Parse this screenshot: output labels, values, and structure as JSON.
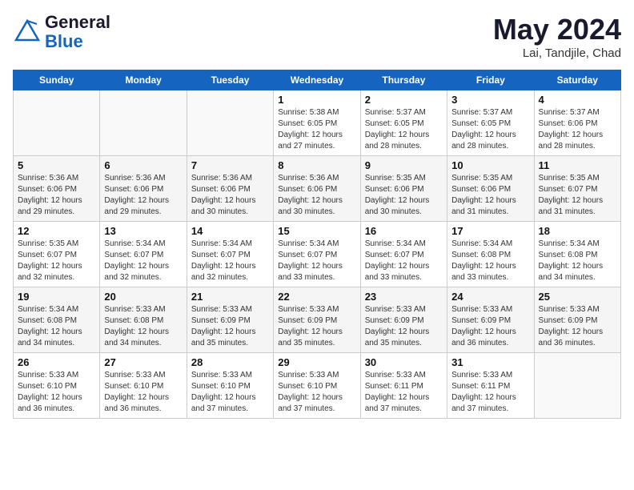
{
  "header": {
    "logo_general": "General",
    "logo_blue": "Blue",
    "month_year": "May 2024",
    "location": "Lai, Tandjile, Chad"
  },
  "days_of_week": [
    "Sunday",
    "Monday",
    "Tuesday",
    "Wednesday",
    "Thursday",
    "Friday",
    "Saturday"
  ],
  "weeks": [
    {
      "shade": false,
      "days": [
        {
          "number": "",
          "info": ""
        },
        {
          "number": "",
          "info": ""
        },
        {
          "number": "",
          "info": ""
        },
        {
          "number": "1",
          "info": "Sunrise: 5:38 AM\nSunset: 6:05 PM\nDaylight: 12 hours\nand 27 minutes."
        },
        {
          "number": "2",
          "info": "Sunrise: 5:37 AM\nSunset: 6:05 PM\nDaylight: 12 hours\nand 28 minutes."
        },
        {
          "number": "3",
          "info": "Sunrise: 5:37 AM\nSunset: 6:05 PM\nDaylight: 12 hours\nand 28 minutes."
        },
        {
          "number": "4",
          "info": "Sunrise: 5:37 AM\nSunset: 6:06 PM\nDaylight: 12 hours\nand 28 minutes."
        }
      ]
    },
    {
      "shade": true,
      "days": [
        {
          "number": "5",
          "info": "Sunrise: 5:36 AM\nSunset: 6:06 PM\nDaylight: 12 hours\nand 29 minutes."
        },
        {
          "number": "6",
          "info": "Sunrise: 5:36 AM\nSunset: 6:06 PM\nDaylight: 12 hours\nand 29 minutes."
        },
        {
          "number": "7",
          "info": "Sunrise: 5:36 AM\nSunset: 6:06 PM\nDaylight: 12 hours\nand 30 minutes."
        },
        {
          "number": "8",
          "info": "Sunrise: 5:36 AM\nSunset: 6:06 PM\nDaylight: 12 hours\nand 30 minutes."
        },
        {
          "number": "9",
          "info": "Sunrise: 5:35 AM\nSunset: 6:06 PM\nDaylight: 12 hours\nand 30 minutes."
        },
        {
          "number": "10",
          "info": "Sunrise: 5:35 AM\nSunset: 6:06 PM\nDaylight: 12 hours\nand 31 minutes."
        },
        {
          "number": "11",
          "info": "Sunrise: 5:35 AM\nSunset: 6:07 PM\nDaylight: 12 hours\nand 31 minutes."
        }
      ]
    },
    {
      "shade": false,
      "days": [
        {
          "number": "12",
          "info": "Sunrise: 5:35 AM\nSunset: 6:07 PM\nDaylight: 12 hours\nand 32 minutes."
        },
        {
          "number": "13",
          "info": "Sunrise: 5:34 AM\nSunset: 6:07 PM\nDaylight: 12 hours\nand 32 minutes."
        },
        {
          "number": "14",
          "info": "Sunrise: 5:34 AM\nSunset: 6:07 PM\nDaylight: 12 hours\nand 32 minutes."
        },
        {
          "number": "15",
          "info": "Sunrise: 5:34 AM\nSunset: 6:07 PM\nDaylight: 12 hours\nand 33 minutes."
        },
        {
          "number": "16",
          "info": "Sunrise: 5:34 AM\nSunset: 6:07 PM\nDaylight: 12 hours\nand 33 minutes."
        },
        {
          "number": "17",
          "info": "Sunrise: 5:34 AM\nSunset: 6:08 PM\nDaylight: 12 hours\nand 33 minutes."
        },
        {
          "number": "18",
          "info": "Sunrise: 5:34 AM\nSunset: 6:08 PM\nDaylight: 12 hours\nand 34 minutes."
        }
      ]
    },
    {
      "shade": true,
      "days": [
        {
          "number": "19",
          "info": "Sunrise: 5:34 AM\nSunset: 6:08 PM\nDaylight: 12 hours\nand 34 minutes."
        },
        {
          "number": "20",
          "info": "Sunrise: 5:33 AM\nSunset: 6:08 PM\nDaylight: 12 hours\nand 34 minutes."
        },
        {
          "number": "21",
          "info": "Sunrise: 5:33 AM\nSunset: 6:09 PM\nDaylight: 12 hours\nand 35 minutes."
        },
        {
          "number": "22",
          "info": "Sunrise: 5:33 AM\nSunset: 6:09 PM\nDaylight: 12 hours\nand 35 minutes."
        },
        {
          "number": "23",
          "info": "Sunrise: 5:33 AM\nSunset: 6:09 PM\nDaylight: 12 hours\nand 35 minutes."
        },
        {
          "number": "24",
          "info": "Sunrise: 5:33 AM\nSunset: 6:09 PM\nDaylight: 12 hours\nand 36 minutes."
        },
        {
          "number": "25",
          "info": "Sunrise: 5:33 AM\nSunset: 6:09 PM\nDaylight: 12 hours\nand 36 minutes."
        }
      ]
    },
    {
      "shade": false,
      "days": [
        {
          "number": "26",
          "info": "Sunrise: 5:33 AM\nSunset: 6:10 PM\nDaylight: 12 hours\nand 36 minutes."
        },
        {
          "number": "27",
          "info": "Sunrise: 5:33 AM\nSunset: 6:10 PM\nDaylight: 12 hours\nand 36 minutes."
        },
        {
          "number": "28",
          "info": "Sunrise: 5:33 AM\nSunset: 6:10 PM\nDaylight: 12 hours\nand 37 minutes."
        },
        {
          "number": "29",
          "info": "Sunrise: 5:33 AM\nSunset: 6:10 PM\nDaylight: 12 hours\nand 37 minutes."
        },
        {
          "number": "30",
          "info": "Sunrise: 5:33 AM\nSunset: 6:11 PM\nDaylight: 12 hours\nand 37 minutes."
        },
        {
          "number": "31",
          "info": "Sunrise: 5:33 AM\nSunset: 6:11 PM\nDaylight: 12 hours\nand 37 minutes."
        },
        {
          "number": "",
          "info": ""
        }
      ]
    }
  ]
}
